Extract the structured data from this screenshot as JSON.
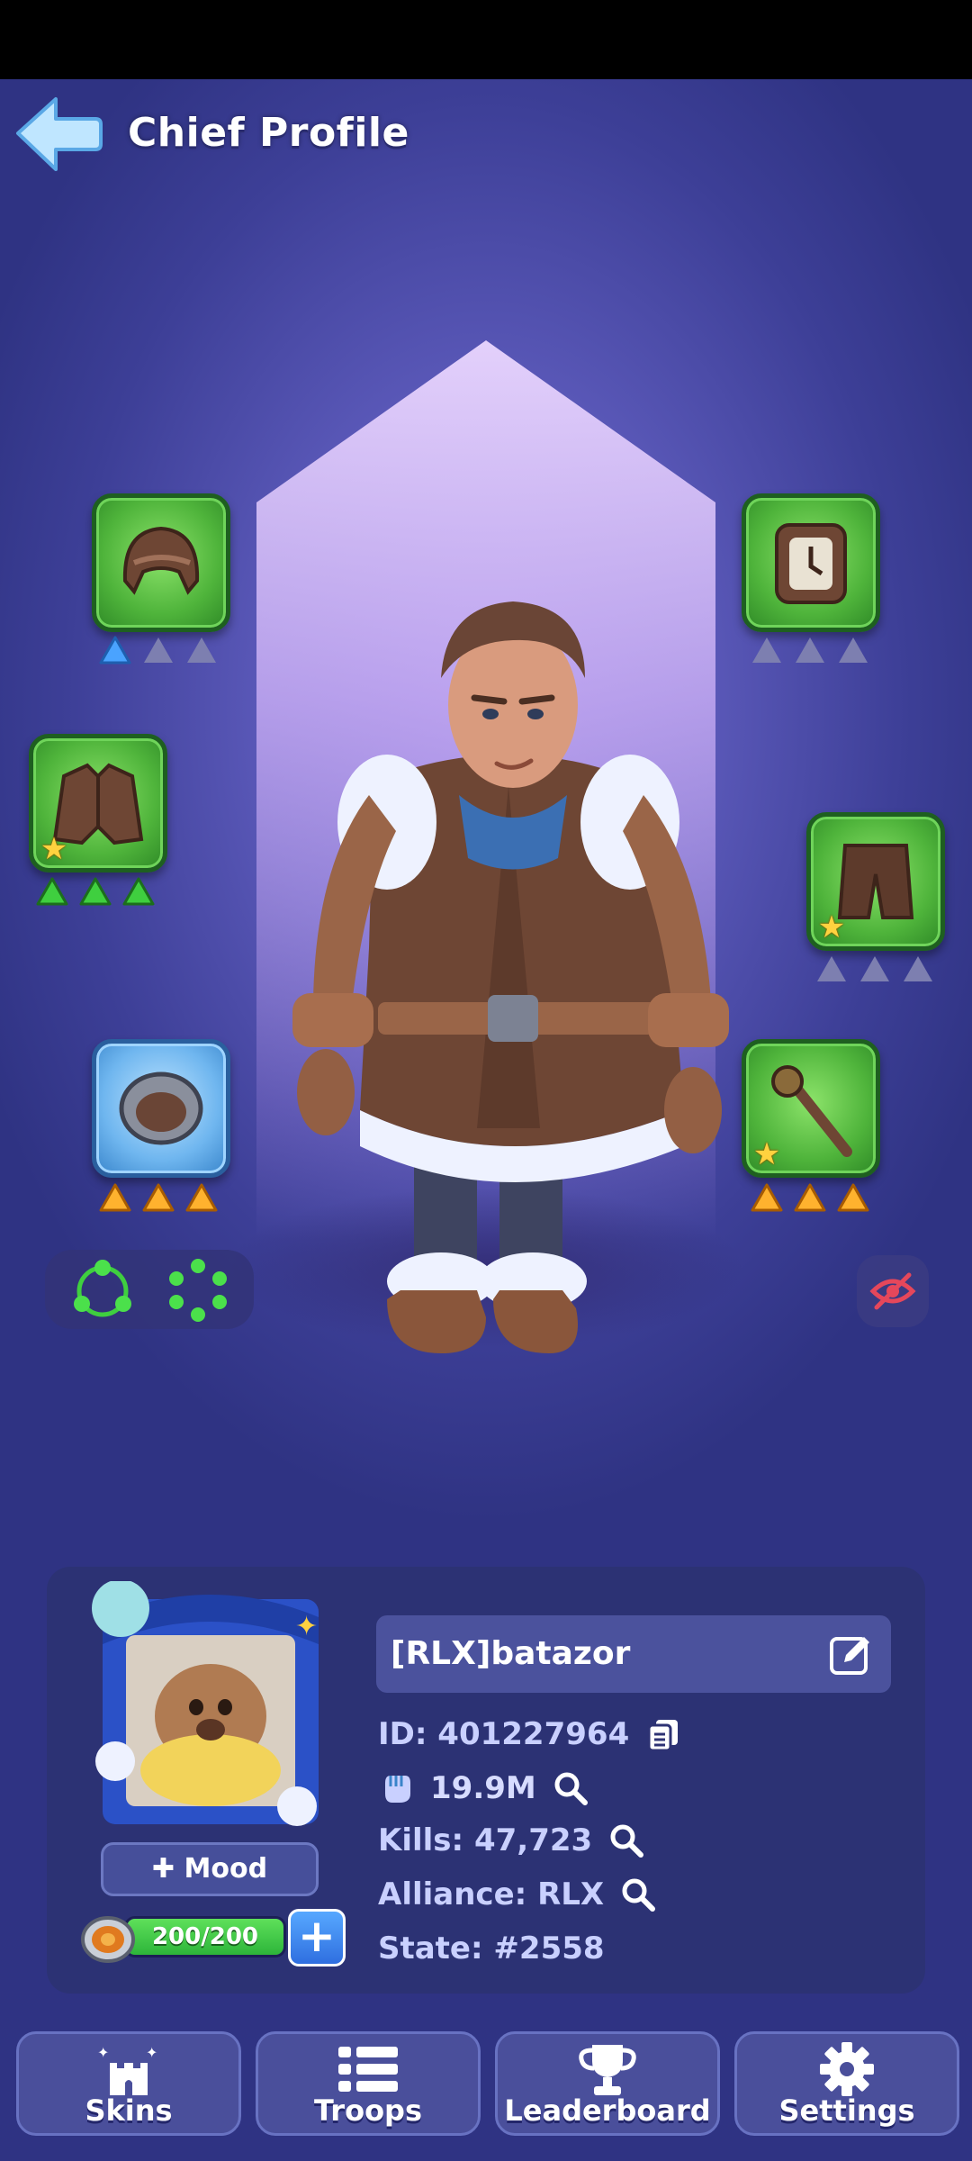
{
  "header": {
    "title": "Chief Profile"
  },
  "colors": {
    "accent_green": "#4fb43b",
    "accent_blue": "#6fb6ef",
    "panel": "#2d3273",
    "background": "#3d3f97"
  },
  "gear": [
    {
      "slot": "cap",
      "star": false,
      "tiers": [
        "blue",
        "empty",
        "empty"
      ]
    },
    {
      "slot": "coat",
      "star": true,
      "tiers": [
        "green",
        "green",
        "green"
      ]
    },
    {
      "slot": "ring",
      "star": false,
      "tiers": [
        "orange",
        "orange",
        "orange"
      ]
    },
    {
      "slot": "watch",
      "star": false,
      "tiers": [
        "empty",
        "empty",
        "empty"
      ]
    },
    {
      "slot": "pants",
      "star": true,
      "tiers": [
        "empty",
        "empty",
        "empty"
      ]
    },
    {
      "slot": "staff",
      "star": true,
      "tiers": [
        "orange",
        "orange",
        "orange"
      ]
    }
  ],
  "profile": {
    "name": "[RLX]batazor",
    "id_label": "ID: 401227964",
    "power": "19.9M",
    "kills_label": "Kills: 47,723",
    "alliance_label": "Alliance: RLX",
    "state_label": "State: #2558",
    "mood_label": "Mood",
    "stamina_text": "200/200",
    "stamina_fraction": 1.0
  },
  "nav": {
    "skins": "Skins",
    "troops": "Troops",
    "leaderboard": "Leaderboard",
    "settings": "Settings"
  },
  "icons": {
    "back": "back-arrow-icon",
    "copy": "copy-icon",
    "search": "search-icon",
    "edit": "edit-icon",
    "hide": "eye-off-icon",
    "power": "fist-icon"
  }
}
